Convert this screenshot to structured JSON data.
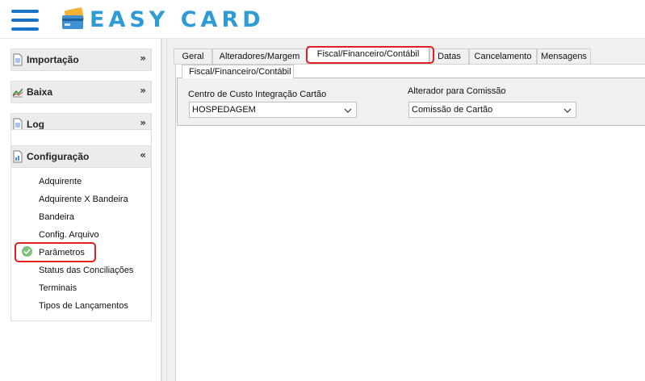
{
  "app": {
    "title": "EASY CARD"
  },
  "icons": {
    "menu": "hamburger-icon",
    "logo": "credit-card-icon",
    "importacao": "document-icon",
    "baixa": "chart-line-icon",
    "log": "document-icon",
    "configuracao": "report-icon",
    "selected": "check-circle-icon"
  },
  "colors": {
    "brand": "#2e9bd6",
    "menu_icon": "#1a73c9",
    "highlight": "#e02020",
    "check": "#7cc27b"
  },
  "sidebar": {
    "groups": [
      {
        "label": "Importação",
        "expanded": false
      },
      {
        "label": "Baixa",
        "expanded": false
      },
      {
        "label": "Log",
        "expanded": false
      },
      {
        "label": "Configuração",
        "expanded": true
      }
    ],
    "config_items": [
      "Adquirente",
      "Adquirente X Bandeira",
      "Bandeira",
      "Config. Arquivo",
      "Parâmetros",
      "Status das Conciliações",
      "Terminais",
      "Tipos de Lançamentos"
    ],
    "selected_item": "Parâmetros"
  },
  "tabs": [
    "Geral",
    "Alteradores/Margem",
    "Fiscal/Financeiro/Contábil",
    "Datas",
    "Cancelamento",
    "Mensagens"
  ],
  "active_tab": "Fiscal/Financeiro/Contábil",
  "subtab": {
    "label": "Fiscal/Financeiro/Contábil"
  },
  "form": {
    "centro_custo": {
      "label": "Centro de Custo Integração Cartão",
      "value": "HOSPEDAGEM"
    },
    "alterador": {
      "label": "Alterador para Comissão",
      "value": "Comissão de Cartão"
    }
  }
}
